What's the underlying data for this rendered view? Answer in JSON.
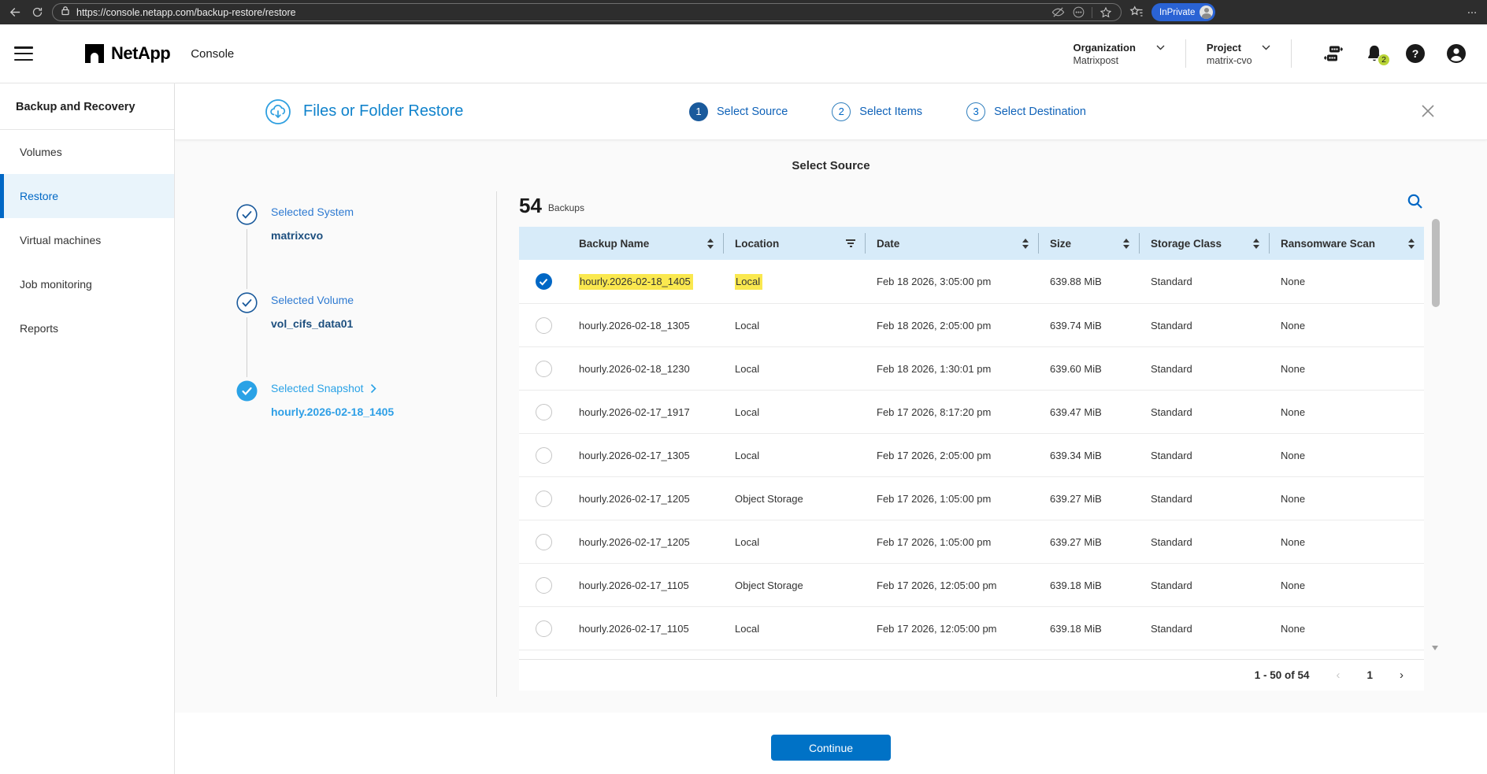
{
  "browser": {
    "url": "https://console.netapp.com/backup-restore/restore",
    "inprivate_label": "InPrivate"
  },
  "header": {
    "brand": "NetApp",
    "app_name": "Console",
    "organization_label": "Organization",
    "organization_value": "Matrixpost",
    "project_label": "Project",
    "project_value": "matrix-cvo",
    "notification_count": "2",
    "help_glyph": "?"
  },
  "sidebar": {
    "title": "Backup and Recovery",
    "items": [
      {
        "label": "Volumes",
        "active": false
      },
      {
        "label": "Restore",
        "active": true
      },
      {
        "label": "Virtual machines",
        "active": false
      },
      {
        "label": "Job monitoring",
        "active": false
      },
      {
        "label": "Reports",
        "active": false
      }
    ]
  },
  "wizard": {
    "title": "Files or Folder Restore",
    "steps": [
      {
        "num": "1",
        "label": "Select Source",
        "state": "active"
      },
      {
        "num": "2",
        "label": "Select Items",
        "state": "upcoming"
      },
      {
        "num": "3",
        "label": "Select Destination",
        "state": "upcoming"
      }
    ]
  },
  "stepper": {
    "items": [
      {
        "label": "Selected System",
        "value": "matrixcvo"
      },
      {
        "label": "Selected Volume",
        "value": "vol_cifs_data01"
      },
      {
        "label": "Selected Snapshot",
        "value": "hourly.2026-02-18_1405"
      }
    ]
  },
  "main": {
    "section_title": "Select Source",
    "count": "54",
    "count_label": "Backups"
  },
  "table": {
    "columns": [
      "Backup Name",
      "Location",
      "Date",
      "Size",
      "Storage Class",
      "Ransomware Scan"
    ],
    "rows": [
      {
        "name": "hourly.2026-02-18_1405",
        "location": "Local",
        "date": "Feb 18 2026, 3:05:00 pm",
        "size": "639.88 MiB",
        "storage_class": "Standard",
        "ransomware_scan": "None",
        "selected": true,
        "highlight_fields": [
          "name",
          "location"
        ]
      },
      {
        "name": "hourly.2026-02-18_1305",
        "location": "Local",
        "date": "Feb 18 2026, 2:05:00 pm",
        "size": "639.74 MiB",
        "storage_class": "Standard",
        "ransomware_scan": "None",
        "selected": false
      },
      {
        "name": "hourly.2026-02-18_1230",
        "location": "Local",
        "date": "Feb 18 2026, 1:30:01 pm",
        "size": "639.60 MiB",
        "storage_class": "Standard",
        "ransomware_scan": "None",
        "selected": false
      },
      {
        "name": "hourly.2026-02-17_1917",
        "location": "Local",
        "date": "Feb 17 2026, 8:17:20 pm",
        "size": "639.47 MiB",
        "storage_class": "Standard",
        "ransomware_scan": "None",
        "selected": false
      },
      {
        "name": "hourly.2026-02-17_1305",
        "location": "Local",
        "date": "Feb 17 2026, 2:05:00 pm",
        "size": "639.34 MiB",
        "storage_class": "Standard",
        "ransomware_scan": "None",
        "selected": false
      },
      {
        "name": "hourly.2026-02-17_1205",
        "location": "Object Storage",
        "date": "Feb 17 2026, 1:05:00 pm",
        "size": "639.27 MiB",
        "storage_class": "Standard",
        "ransomware_scan": "None",
        "selected": false
      },
      {
        "name": "hourly.2026-02-17_1205",
        "location": "Local",
        "date": "Feb 17 2026, 1:05:00 pm",
        "size": "639.27 MiB",
        "storage_class": "Standard",
        "ransomware_scan": "None",
        "selected": false
      },
      {
        "name": "hourly.2026-02-17_1105",
        "location": "Object Storage",
        "date": "Feb 17 2026, 12:05:00 pm",
        "size": "639.18 MiB",
        "storage_class": "Standard",
        "ransomware_scan": "None",
        "selected": false
      },
      {
        "name": "hourly.2026-02-17_1105",
        "location": "Local",
        "date": "Feb 17 2026, 12:05:00 pm",
        "size": "639.18 MiB",
        "storage_class": "Standard",
        "ransomware_scan": "None",
        "selected": false
      }
    ]
  },
  "pagination": {
    "range": "1 - 50 of 54",
    "page": "1"
  },
  "footer": {
    "continue_label": "Continue"
  },
  "colors": {
    "accent_blue": "#0067C5",
    "title_blue": "#1083cc",
    "step_dark_blue": "#1a5a9c",
    "snapshot_light_blue": "#2aa2e6",
    "table_header_bg": "#d7ebf9",
    "highlight_yellow": "#fae84f",
    "notification_badge_green": "#b9d437",
    "inprivate_blue": "#2a63d4",
    "continue_button_blue": "#0072C6",
    "active_item_bg": "#e9f4fb"
  }
}
